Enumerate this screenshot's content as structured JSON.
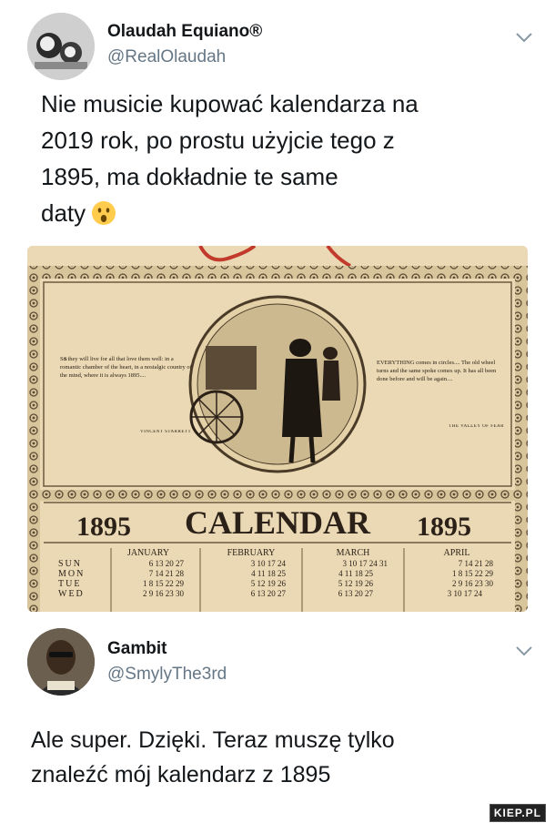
{
  "tweets": [
    {
      "author_name": "Olaudah Equiano®",
      "author_handle": "@RealOlaudah",
      "text_lines": [
        "Nie musicie kupować kalendarza na",
        "2019 rok, po prostu użyjcie tego z",
        "1895, ma dokładnie te same",
        "daty"
      ],
      "emoji": "surprised-face-emoji"
    },
    {
      "author_name": "Gambit",
      "author_handle": "@SmylyThe3rd",
      "text_lines": [
        "Ale super. Dzięki. Teraz muszę tylko",
        "znaleźć mój kalendarz z 1895"
      ]
    }
  ],
  "calendar_image": {
    "year_left": "1895",
    "title": "CALENDAR",
    "year_right": "1895",
    "quote_left": "So they will live for all that love them well: in a romantic chamber of the heart, in a nostalgic country of the mind, where it is always 1895....",
    "quote_left_author": "VINCENT STARRETT",
    "quote_right": "EVERYTHING comes in circles.... The old wheel turns and the same spoke comes up. It has all been done before and will be again....",
    "quote_right_author": "THE VALLEY OF FEAR",
    "day_labels": [
      "SUN",
      "MON",
      "TUE",
      "WED"
    ],
    "months": [
      {
        "name": "JANUARY",
        "rows": [
          "6 13 20 27",
          "7 14 21 28",
          "1  8 15 22 29",
          "2  9 16 23 30"
        ]
      },
      {
        "name": "FEBRUARY",
        "rows": [
          "3 10 17 24",
          "4 11 18 25",
          "5 12 19 26",
          "6 13 20 27"
        ]
      },
      {
        "name": "MARCH",
        "rows": [
          "3 10 17 24 31",
          "4 11 18 25",
          "5 12 19 26",
          "6 13 20 27"
        ]
      },
      {
        "name": "APRIL",
        "rows": [
          "7 14 21 28",
          "1  8 15 22 29",
          "2  9 16 23 30",
          "3 10 17 24"
        ]
      }
    ]
  },
  "watermark": "KIEP.PL",
  "colors": {
    "paper": "#ead9b4",
    "ink": "#2b2118",
    "border": "#6e5a3e",
    "ribbon": "#c23a2c",
    "handle_gray": "#657786"
  }
}
